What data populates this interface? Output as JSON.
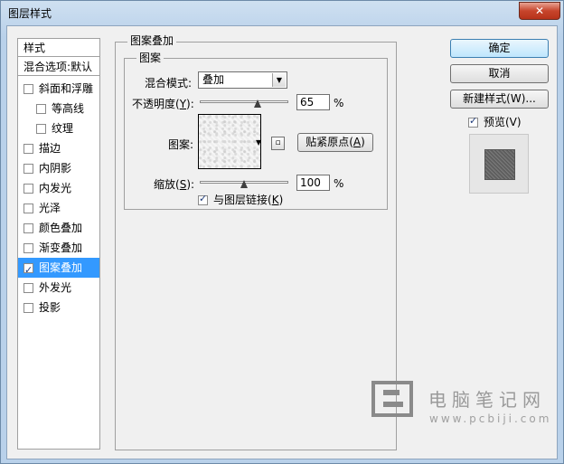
{
  "window": {
    "title": "图层样式",
    "close_glyph": "✕"
  },
  "styles_list": {
    "header": "样式",
    "blend_options": "混合选项:默认",
    "items": [
      {
        "label": "斜面和浮雕",
        "checked": false,
        "indent": false
      },
      {
        "label": "等高线",
        "checked": false,
        "indent": true
      },
      {
        "label": "纹理",
        "checked": false,
        "indent": true
      },
      {
        "label": "描边",
        "checked": false,
        "indent": false
      },
      {
        "label": "内阴影",
        "checked": false,
        "indent": false
      },
      {
        "label": "内发光",
        "checked": false,
        "indent": false
      },
      {
        "label": "光泽",
        "checked": false,
        "indent": false
      },
      {
        "label": "颜色叠加",
        "checked": false,
        "indent": false
      },
      {
        "label": "渐变叠加",
        "checked": false,
        "indent": false
      },
      {
        "label": "图案叠加",
        "checked": true,
        "indent": false,
        "selected": true
      },
      {
        "label": "外发光",
        "checked": false,
        "indent": false
      },
      {
        "label": "投影",
        "checked": false,
        "indent": false
      }
    ]
  },
  "panel": {
    "group_title": "图案叠加",
    "subgroup_title": "图案",
    "blend_mode_label": "混合模式:",
    "blend_mode_value": "叠加",
    "opacity_label_a": "不透明度(",
    "opacity_label_key": "Y",
    "opacity_label_b": "):",
    "opacity_value": "65",
    "opacity_unit": "%",
    "opacity_fraction": 0.65,
    "pattern_label": "图案:",
    "snap_button_a": "贴紧原点(",
    "snap_button_key": "A",
    "snap_button_b": ")",
    "scale_label_a": "缩放(",
    "scale_label_key": "S",
    "scale_label_b": "):",
    "scale_value": "100",
    "scale_unit": "%",
    "scale_fraction": 0.5,
    "link_label_a": "与图层链接(",
    "link_label_key": "K",
    "link_label_b": ")",
    "link_checked": true
  },
  "actions": {
    "ok": "确定",
    "cancel": "取消",
    "new_style": "新建样式(W)...",
    "preview_label": "预览(V)",
    "preview_checked": true
  },
  "watermark": {
    "text_cn": "电脑笔记网",
    "text_url": "www.pcbiji.com"
  }
}
